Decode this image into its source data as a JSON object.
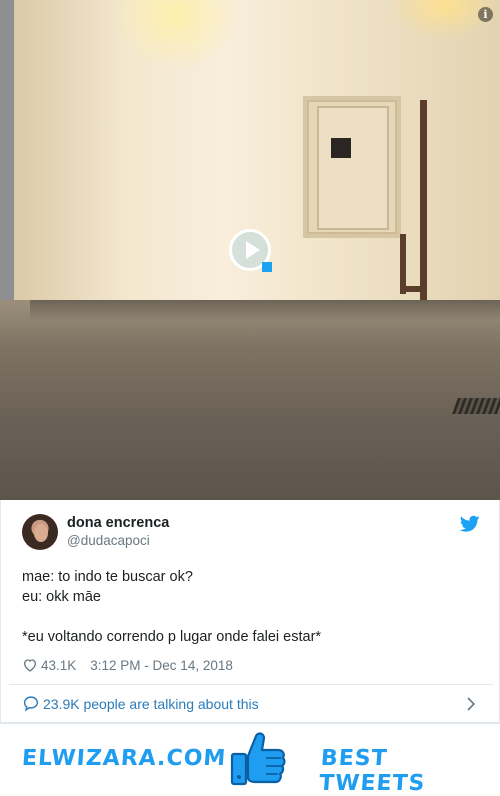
{
  "video": {
    "play_label": "Play video",
    "info_label": "i"
  },
  "tweet": {
    "display_name": "dona encrenca",
    "handle": "@dudacapoci",
    "text_lines": [
      "mae: to indo te buscar ok?",
      "eu: okk māe",
      "",
      "*eu voltando correndo p lugar onde falei estar*"
    ],
    "likes": "43.1K",
    "timestamp": "3:12 PM - Dec 14, 2018",
    "talking": "23.9K people are talking about this"
  },
  "banner": {
    "brand": "ELWIZARA.COM",
    "tagline": "BEST TWEETS"
  },
  "colors": {
    "accent": "#1da1f2",
    "link": "#2b7bb9",
    "muted": "#697882",
    "banner_text": "#1f9df0"
  },
  "icons": [
    "info-icon",
    "play-icon",
    "twitter-bird-icon",
    "heart-icon",
    "speech-bubble-icon",
    "chevron-right-icon",
    "thumbs-up-icon"
  ]
}
